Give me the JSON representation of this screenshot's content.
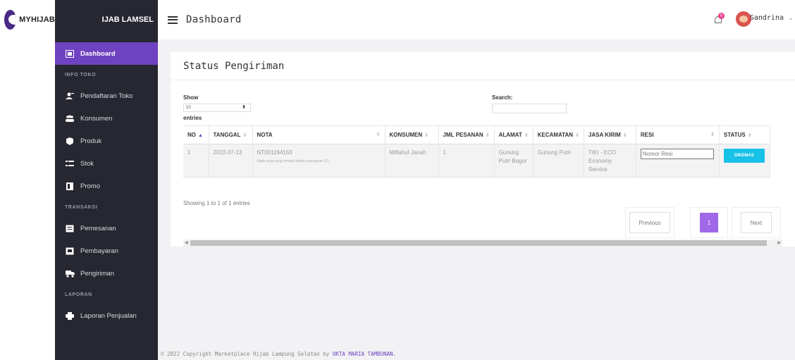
{
  "brand": {
    "logo_text": "MYHIJAB",
    "store_name": "IJAB LAMSEL"
  },
  "header": {
    "title": "Dashboard",
    "notification_count": "0",
    "user_name": "Sandrina"
  },
  "sidebar": {
    "active": "Dashboard",
    "sections": [
      {
        "heading": "INFO TOKO",
        "items": [
          "Pendaftaran Toko",
          "Konsumen",
          "Produk",
          "Stok",
          "Promo"
        ]
      },
      {
        "heading": "TRANSAKSI",
        "items": [
          "Pemesanan",
          "Pembayaran",
          "Pengiriman"
        ]
      },
      {
        "heading": "LAPORAN",
        "items": [
          "Laporan Penjualan"
        ]
      }
    ]
  },
  "card": {
    "title": "Status Pengiriman",
    "show_label": "Show",
    "length_value": "10",
    "entries_label": "entries",
    "search_label": "Search:",
    "columns": [
      "NO",
      "TANGGAL",
      "NOTA",
      "KONSUMEN",
      "JML PESANAN",
      "ALAMAT",
      "KECAMATAN",
      "JASA KIRIM",
      "RESI",
      "STATUS"
    ],
    "rows": [
      {
        "no": "1",
        "tanggal": "2022-07-13",
        "nota": "NT001164163",
        "nota_detail": "hijab zoya segi empat bahan polyspun (1),",
        "konsumen": "Miftahul Janah",
        "jml_pesanan": "1",
        "alamat": "Gunung Putri Bogor",
        "kecamatan": "Gunung Putri",
        "jasa_kirim": "TIKI - ECO Economy Service",
        "resi_placeholder": "Nomor Resi",
        "status": "DIKEMAS"
      }
    ],
    "info": "Showing 1 to 1 of 1 entries",
    "pagination": {
      "previous": "Previous",
      "current": "1",
      "next": "Next"
    }
  },
  "footer": {
    "text": "© 2022 Copyright Marketplace Hijab Lampung Selatan by",
    "link": "OKTA MARIA TAMBUNAN."
  },
  "colors": {
    "sidebar_bg": "#262730",
    "accent": "#6f42c1",
    "status_btn": "#17c1e8",
    "page_bg": "#f2f2f4"
  }
}
